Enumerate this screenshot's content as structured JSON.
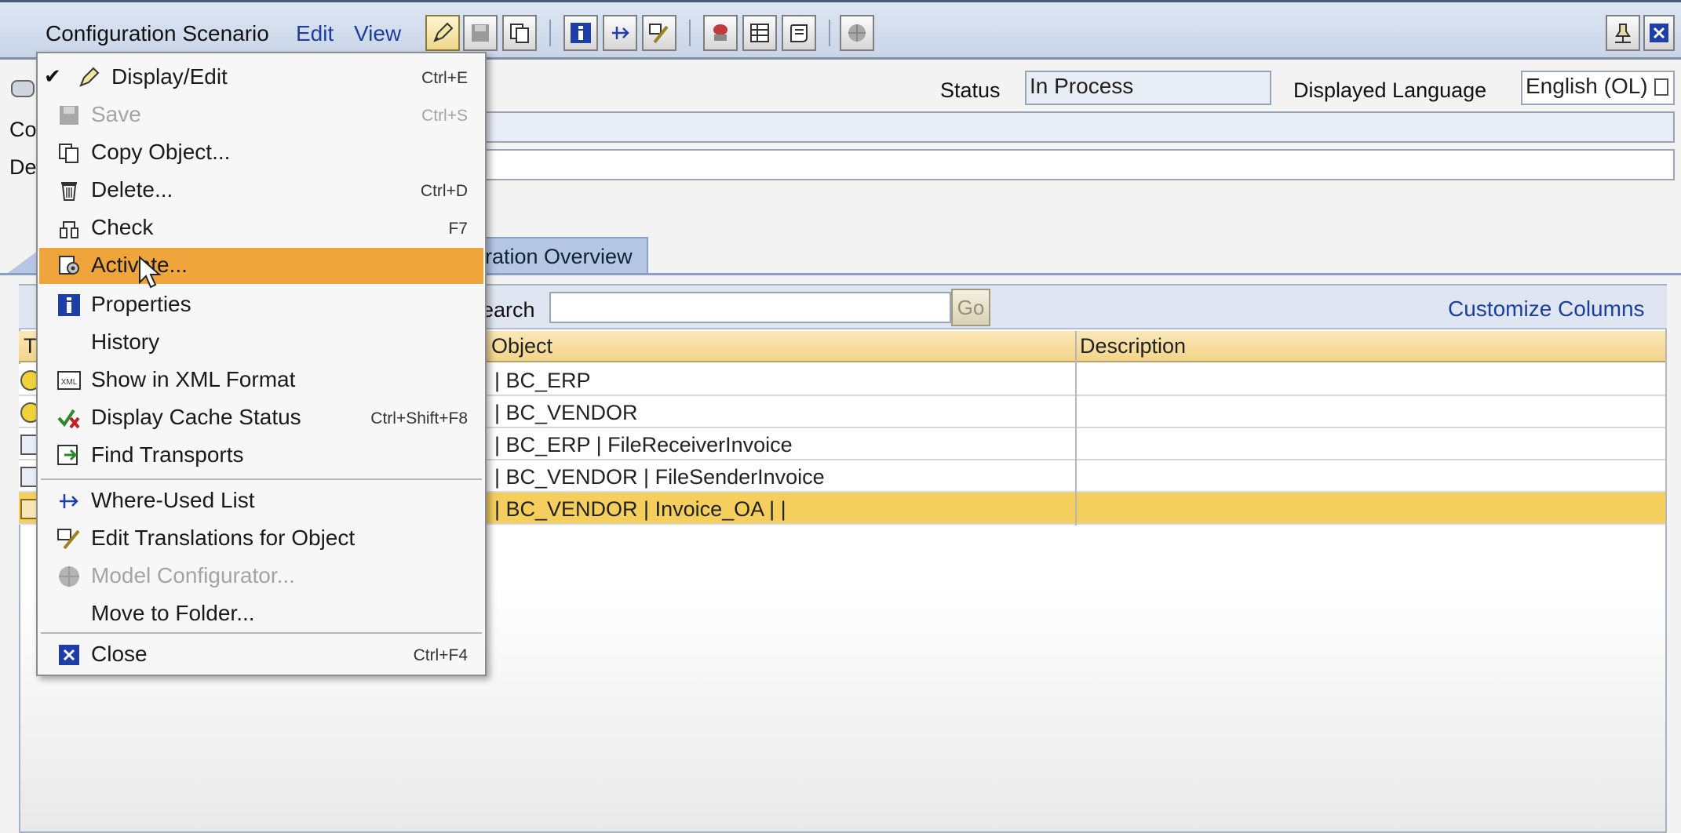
{
  "menubar": {
    "items": [
      "Configuration Scenario",
      "Edit",
      "View"
    ]
  },
  "toolbar": {
    "buttons": [
      "edit-pencil-icon",
      "save-icon",
      "copy-icon",
      "properties-icon",
      "where-used-icon",
      "translate-icon",
      "model-icon",
      "grid-icon",
      "script-icon",
      "model-configurator-icon"
    ],
    "right_buttons": [
      "pin-icon",
      "close-icon"
    ]
  },
  "header": {
    "status_label": "Status",
    "status_value": "In Process",
    "language_label": "Displayed Language",
    "language_value": "English (OL)",
    "partial_label_1": "Co",
    "partial_label_2": "De"
  },
  "tab": {
    "visible_label": "ration Overview"
  },
  "table": {
    "search_label": "earch",
    "search_value": "",
    "go_label": "Go",
    "customize_label": "Customize Columns",
    "first_col_partial": "T",
    "columns": [
      "Object",
      "Description"
    ],
    "rows": [
      {
        "object": "| BC_ERP",
        "description": "",
        "selected": false
      },
      {
        "object": "| BC_VENDOR",
        "description": "",
        "selected": false
      },
      {
        "object": "| BC_ERP | FileReceiverInvoice",
        "description": "",
        "selected": false
      },
      {
        "object": "| BC_VENDOR | FileSenderInvoice",
        "description": "",
        "selected": false
      },
      {
        "object": "| BC_VENDOR | Invoice_OA |  |",
        "description": "",
        "selected": true
      }
    ]
  },
  "dropdown": {
    "items": [
      {
        "label": "Display/Edit",
        "shortcut": "Ctrl+E",
        "checked": true,
        "disabled": false,
        "icon": "pencil-icon"
      },
      {
        "label": "Save",
        "shortcut": "Ctrl+S",
        "disabled": true,
        "icon": "save-icon"
      },
      {
        "label": "Copy Object...",
        "shortcut": "",
        "disabled": false,
        "icon": "copy-icon"
      },
      {
        "label": "Delete...",
        "shortcut": "Ctrl+D",
        "disabled": false,
        "icon": "trash-icon"
      },
      {
        "label": "Check",
        "shortcut": "F7",
        "disabled": false,
        "icon": "check-icon"
      },
      {
        "label": "Activate...",
        "shortcut": "",
        "disabled": false,
        "highlighted": true,
        "icon": "activate-icon"
      },
      {
        "label": "Properties",
        "shortcut": "",
        "disabled": false,
        "icon": "info-icon"
      },
      {
        "label": "History",
        "shortcut": "",
        "disabled": false,
        "icon": ""
      },
      {
        "label": "Show in XML Format",
        "shortcut": "",
        "disabled": false,
        "icon": "xml-icon"
      },
      {
        "label": "Display Cache Status",
        "shortcut": "Ctrl+Shift+F8",
        "disabled": false,
        "icon": "cache-icon"
      },
      {
        "label": "Find Transports",
        "shortcut": "",
        "disabled": false,
        "icon": "transport-icon"
      },
      {
        "label": "Where-Used List",
        "shortcut": "",
        "disabled": false,
        "icon": "where-used-icon"
      },
      {
        "label": "Edit Translations for Object",
        "shortcut": "",
        "disabled": false,
        "icon": "translate-icon"
      },
      {
        "label": "Model Configurator...",
        "shortcut": "",
        "disabled": true,
        "icon": "model-configurator-icon"
      },
      {
        "label": "Move to Folder...",
        "shortcut": "",
        "disabled": false,
        "icon": ""
      },
      {
        "label": "Close",
        "shortcut": "Ctrl+F4",
        "disabled": false,
        "icon": "close-icon"
      }
    ]
  },
  "colors": {
    "menu_highlight": "#f0a43c",
    "selected_row": "#f5cf5e",
    "link_blue": "#1a3fa0",
    "toolbar_bg": "#c9d5e8"
  }
}
